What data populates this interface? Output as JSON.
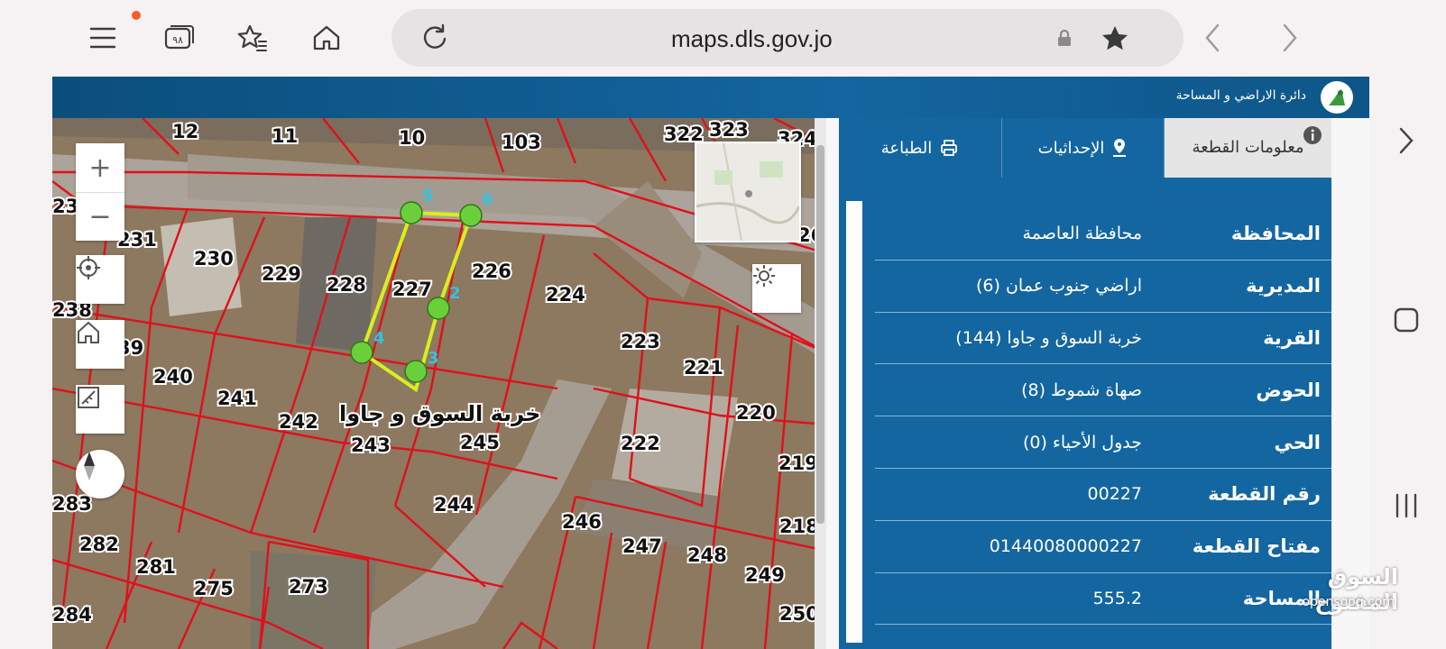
{
  "browser": {
    "url": "maps.dls.gov.jo",
    "tab_count": "٩٨"
  },
  "site": {
    "title": "دائرة الاراضي و المساحة"
  },
  "panel": {
    "tabs": {
      "info": "معلومات القطعة",
      "coordinates": "الإحداثيات",
      "print": "الطباعة"
    },
    "rows": [
      {
        "label": "المحافظة",
        "value": "محافظة العاصمة"
      },
      {
        "label": "المديرية",
        "value": "اراضي جنوب عمان (6)"
      },
      {
        "label": "القرية",
        "value": "خربة السوق و جاوا (144)"
      },
      {
        "label": "الحوض",
        "value": "صهاة شموط (8)"
      },
      {
        "label": "الحي",
        "value": "جدول الأحياء (0)"
      },
      {
        "label": "رقم القطعة",
        "value": "00227"
      },
      {
        "label": "مفتاح القطعة",
        "value": "01440080000227"
      },
      {
        "label": "المساحة",
        "value": "555.2"
      }
    ]
  },
  "map": {
    "village_label": "خربة السوق و جاوا",
    "parcels": [
      "12",
      "11",
      "10",
      "103",
      "322",
      "323",
      "324",
      "23",
      "231",
      "230",
      "229",
      "228",
      "227",
      "226",
      "224",
      "223",
      "221",
      "220",
      "219",
      "218",
      "238",
      "240",
      "241",
      "242",
      "243",
      "245",
      "244",
      "222",
      "246",
      "247",
      "248",
      "249",
      "250",
      "283",
      "282",
      "281",
      "275",
      "273",
      "284",
      "26",
      "39"
    ],
    "vertices": [
      "5",
      "6",
      "2",
      "3",
      "4"
    ],
    "colors": {
      "boundary": "#e0101a",
      "selected": "#d8ef1c",
      "vertex": "#6bcf3c"
    }
  },
  "watermark": {
    "arabic": "السوق المفتوح",
    "latin": "opensooq.com"
  }
}
